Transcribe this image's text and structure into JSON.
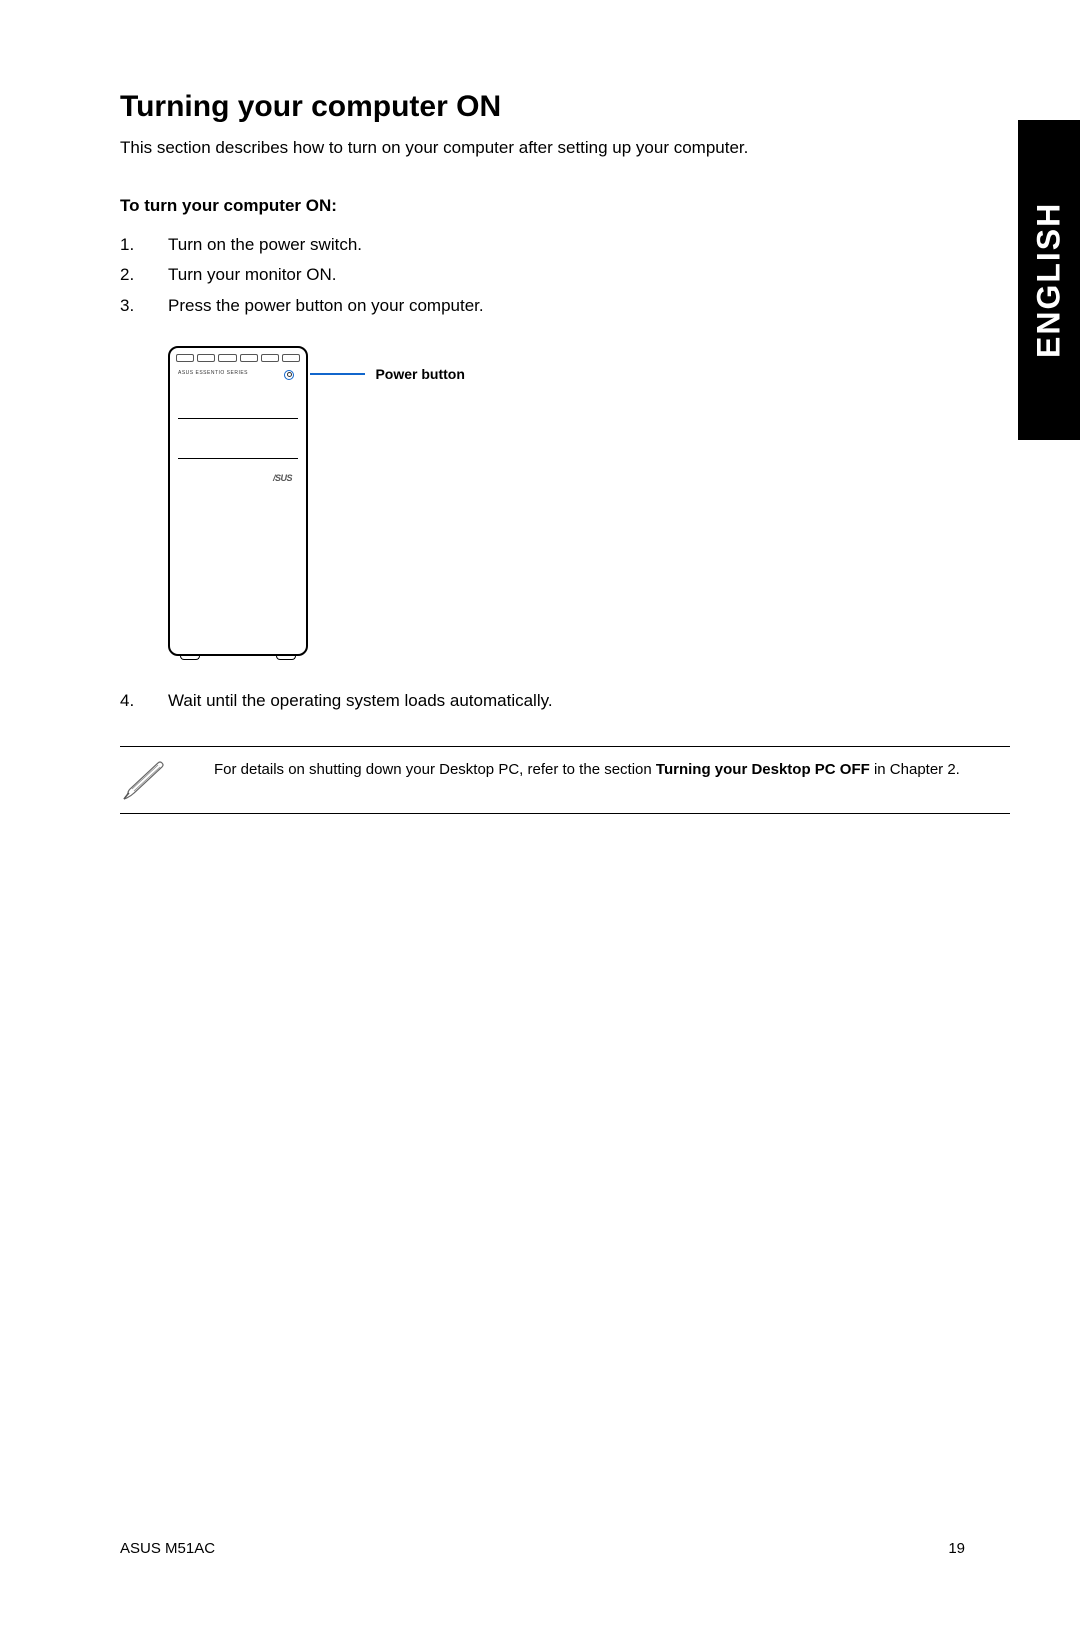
{
  "language_tab": "ENGLISH",
  "heading": "Turning your computer ON",
  "intro": "This section describes how to turn on your computer after setting up your computer.",
  "subheading": "To turn your computer ON:",
  "steps": {
    "s1": "Turn on the power switch.",
    "s2": "Turn your monitor ON.",
    "s3": "Press the power button on your computer."
  },
  "diagram": {
    "callout_label": "Power button",
    "brand_small": "ASUS ESSENTIO SERIES",
    "logo": "/SUS"
  },
  "step4_num": "4.",
  "step4": "Wait until the operating system loads automatically.",
  "note": {
    "prefix": "For details on shutting down your Desktop PC, refer to the section ",
    "bold": "Turning your Desktop PC OFF",
    "suffix": " in Chapter 2."
  },
  "footer": {
    "model": "ASUS M51AC",
    "page_number": "19"
  }
}
